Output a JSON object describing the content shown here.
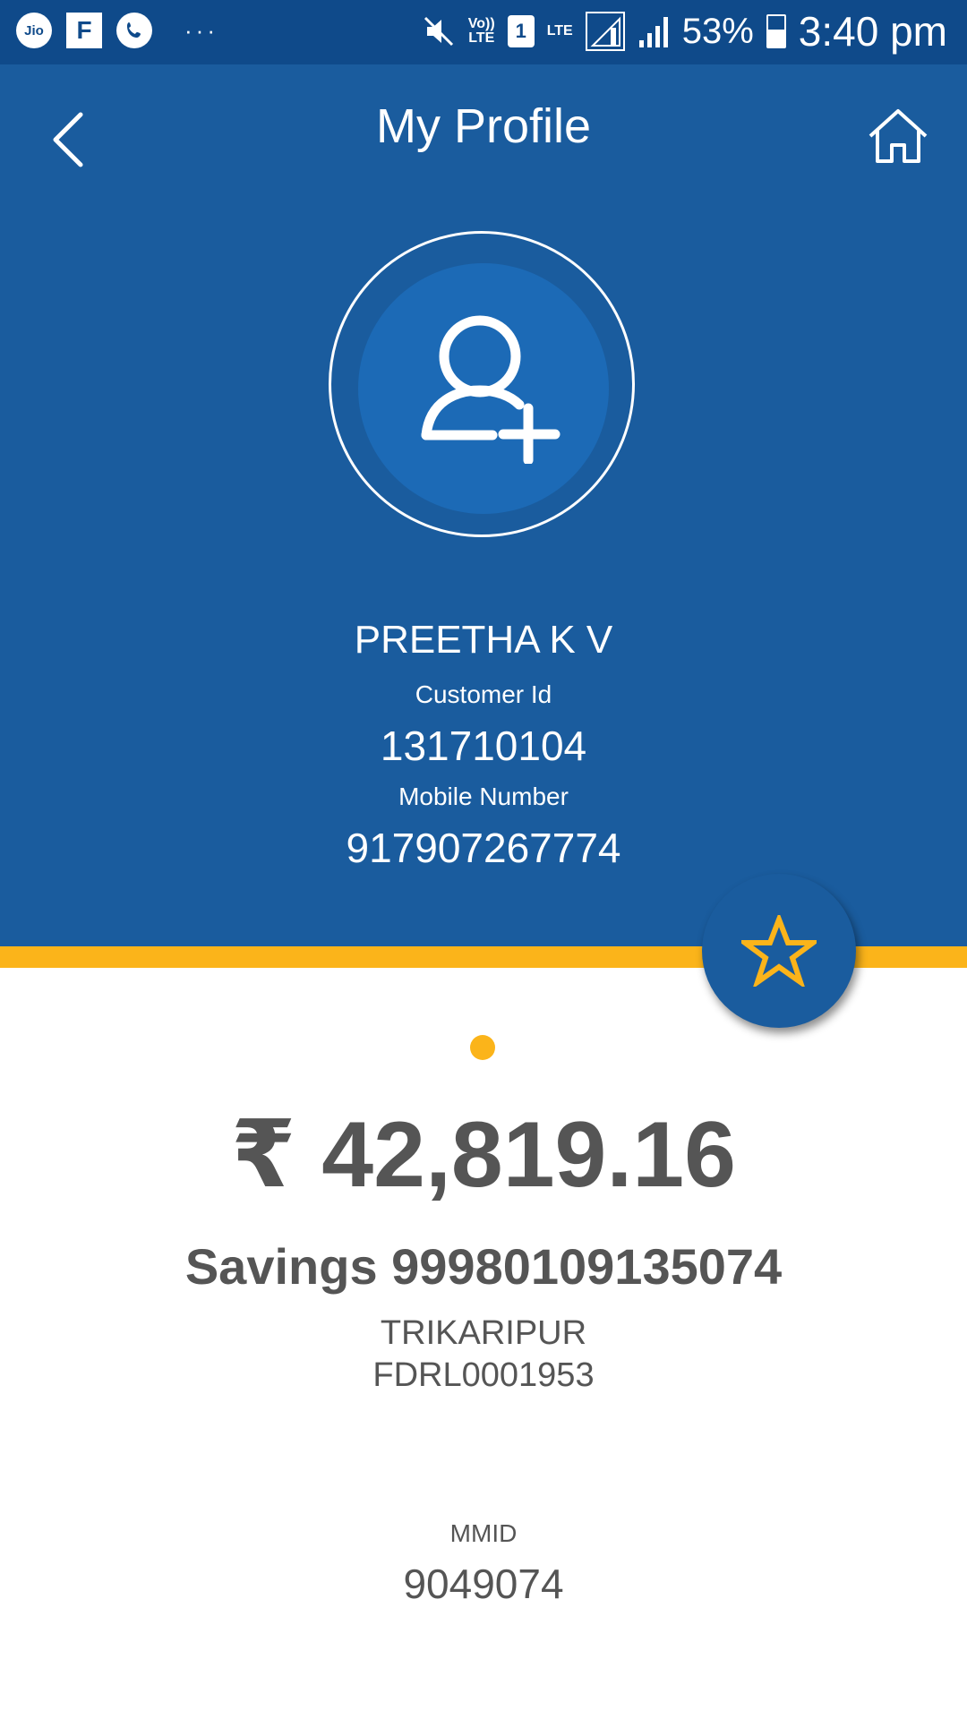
{
  "status_bar": {
    "carrier_icon": "jio-icon",
    "app_icon": "flipboard-icon",
    "call_icon": "phone-icon",
    "more": "···",
    "volte_top": "Vo))",
    "volte_bottom": "LTE",
    "sim": "1",
    "lte": "LTE",
    "battery_pct": "53%",
    "time": "3:40 pm"
  },
  "header": {
    "title": "My Profile",
    "back_icon": "chevron-left-icon",
    "home_icon": "home-icon"
  },
  "profile": {
    "avatar_icon": "add-user-icon",
    "name": "PREETHA K V",
    "customer_id_label": "Customer Id",
    "customer_id": "131710104",
    "mobile_label": "Mobile Number",
    "mobile": "917907267774",
    "favorite_icon": "star-icon"
  },
  "account": {
    "balance": "₹ 42,819.16",
    "type_number": "Savings 99980109135074",
    "branch": "TRIKARIPUR",
    "ifsc": "FDRL0001953",
    "mmid_label": "MMID",
    "mmid": "9049074"
  },
  "colors": {
    "primary": "#1a5c9e",
    "status_bar": "#0f4a8a",
    "accent": "#fbb41a",
    "text": "#555555"
  }
}
